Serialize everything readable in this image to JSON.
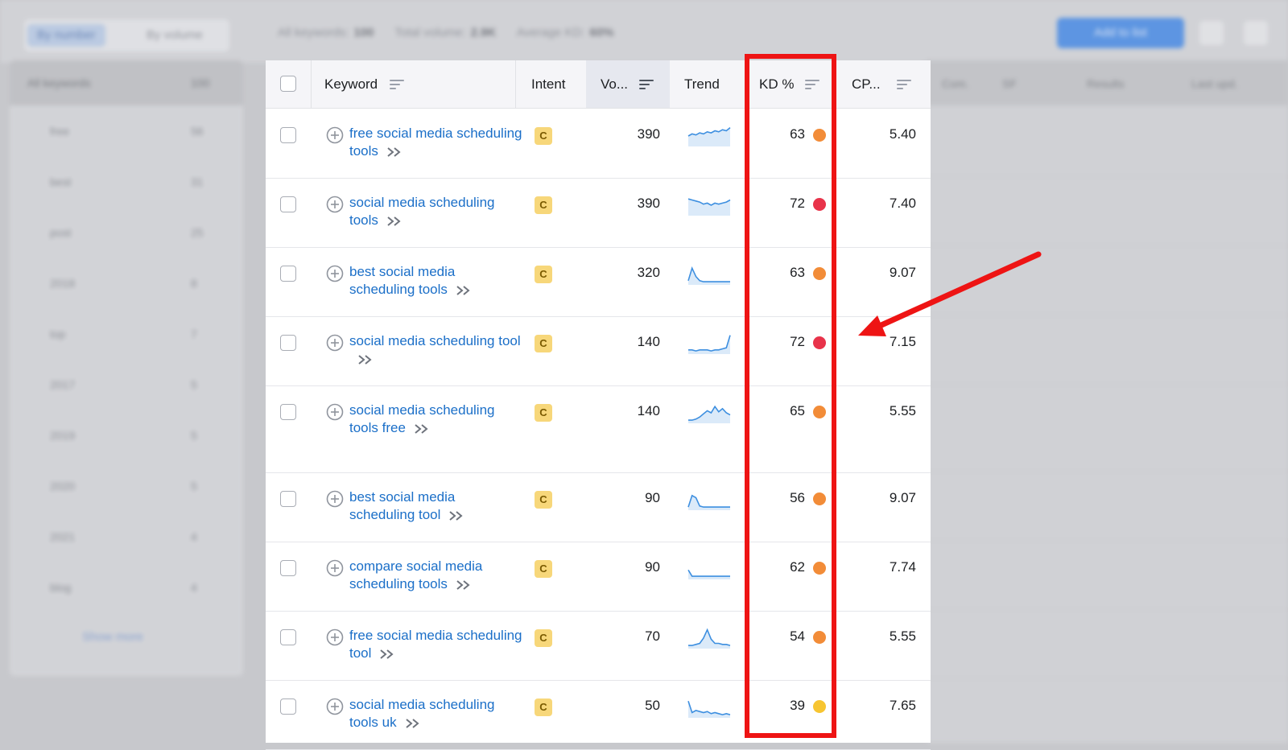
{
  "background": {
    "tabs": [
      "By number",
      "By volume"
    ],
    "stats": [
      {
        "label": "All keywords:",
        "value": "100"
      },
      {
        "label": "Total volume:",
        "value": "2.9K"
      },
      {
        "label": "Average KD:",
        "value": "60%"
      }
    ],
    "add_button_label": "Add to list",
    "sidebar": {
      "header_label": "All keywords",
      "header_count": "100",
      "items": [
        {
          "name": "free",
          "count": "56"
        },
        {
          "name": "best",
          "count": "31"
        },
        {
          "name": "post",
          "count": "25"
        },
        {
          "name": "2018",
          "count": "8"
        },
        {
          "name": "top",
          "count": "7"
        },
        {
          "name": "2017",
          "count": "5"
        },
        {
          "name": "2019",
          "count": "5"
        },
        {
          "name": "2020",
          "count": "5"
        },
        {
          "name": "2021",
          "count": "4"
        },
        {
          "name": "blog",
          "count": "4"
        }
      ],
      "show_more": "Show more"
    },
    "right_columns": [
      "Com.",
      "SF",
      "Results",
      "Last upd."
    ]
  },
  "table": {
    "headers": {
      "keyword": "Keyword",
      "intent": "Intent",
      "volume": "Vo...",
      "trend": "Trend",
      "kd": "KD %",
      "cpc": "CP..."
    },
    "rows": [
      {
        "keyword": "free social media scheduling tools",
        "intent": "C",
        "volume": "390",
        "trend": [
          10,
          12,
          11,
          13,
          12,
          14,
          13,
          15,
          14,
          16,
          15,
          18
        ],
        "kd": "63",
        "kd_color": "#f28c38",
        "cpc": "5.40"
      },
      {
        "keyword": "social media scheduling tools",
        "intent": "C",
        "volume": "390",
        "trend": [
          16,
          15,
          14,
          13,
          11,
          12,
          10,
          12,
          11,
          12,
          13,
          15
        ],
        "kd": "72",
        "kd_color": "#e8334a",
        "cpc": "7.40"
      },
      {
        "keyword": "best social media scheduling tools",
        "intent": "C",
        "volume": "320",
        "trend": [
          4,
          16,
          8,
          4,
          3,
          3,
          3,
          3,
          3,
          3,
          3,
          3
        ],
        "kd": "63",
        "kd_color": "#f28c38",
        "cpc": "9.07"
      },
      {
        "keyword": "social media scheduling tool",
        "intent": "C",
        "volume": "140",
        "trend": [
          4,
          4,
          3,
          4,
          4,
          4,
          3,
          4,
          4,
          5,
          6,
          18
        ],
        "kd": "72",
        "kd_color": "#e8334a",
        "cpc": "7.15"
      },
      {
        "keyword": "social media scheduling tools free",
        "intent": "C",
        "volume": "140",
        "trend": [
          3,
          3,
          4,
          6,
          9,
          12,
          10,
          16,
          11,
          14,
          10,
          8
        ],
        "kd": "65",
        "kd_color": "#f28c38",
        "cpc": "5.55"
      },
      {
        "keyword": "best social media scheduling tool",
        "intent": "C",
        "volume": "90",
        "trend": [
          3,
          14,
          12,
          4,
          3,
          3,
          3,
          3,
          3,
          3,
          3,
          3
        ],
        "kd": "56",
        "kd_color": "#f28c38",
        "cpc": "9.07"
      },
      {
        "keyword": "compare social media scheduling tools",
        "intent": "C",
        "volume": "90",
        "trend": [
          9,
          3,
          3,
          3,
          3,
          3,
          3,
          3,
          3,
          3,
          3,
          3
        ],
        "kd": "62",
        "kd_color": "#f28c38",
        "cpc": "7.74"
      },
      {
        "keyword": "free social media scheduling tool",
        "intent": "C",
        "volume": "70",
        "trend": [
          3,
          3,
          4,
          5,
          10,
          18,
          9,
          5,
          5,
          4,
          4,
          3
        ],
        "kd": "54",
        "kd_color": "#f28c38",
        "cpc": "5.55"
      },
      {
        "keyword": "social media scheduling tools uk",
        "intent": "C",
        "volume": "50",
        "trend": [
          16,
          5,
          7,
          6,
          5,
          6,
          4,
          5,
          4,
          3,
          4,
          3
        ],
        "kd": "39",
        "kd_color": "#f7c531",
        "cpc": "7.65"
      }
    ]
  },
  "colors": {
    "link": "#1b6fc8",
    "highlight": "#ee1414",
    "trend_line": "#3d8fe0",
    "trend_fill": "#dbeaf9",
    "intent_badge": "#f7d77a"
  }
}
